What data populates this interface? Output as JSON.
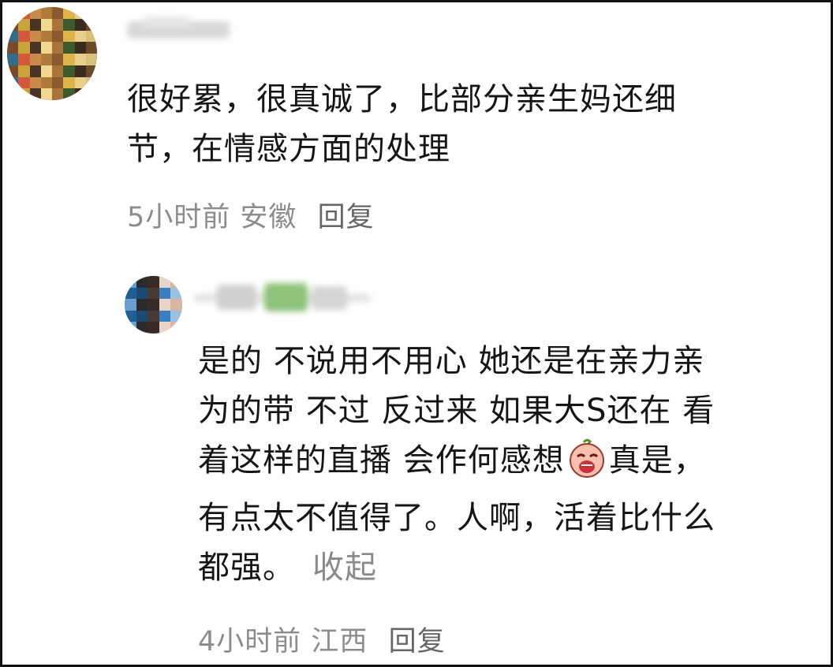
{
  "comments": [
    {
      "text": "很好累，很真诚了，比部分亲生妈还细\n节，在情感方面的处理",
      "time": "5小时前",
      "location": "安徽",
      "reply_label": "回复"
    },
    {
      "text_before_emoji": "是的 不说用不用心 她还是在亲力亲\n为的带 不过 反过来 如果大S还在 看\n着这样的直播 会作何感想",
      "emoji_icon": "crying-face-emoji-icon",
      "text_after_emoji": "真是，\n有点太不值得了。人啊，活着比什么\n都强。",
      "collapse_label": "收起",
      "time": "4小时前",
      "location": "江西",
      "reply_label": "回复"
    }
  ]
}
